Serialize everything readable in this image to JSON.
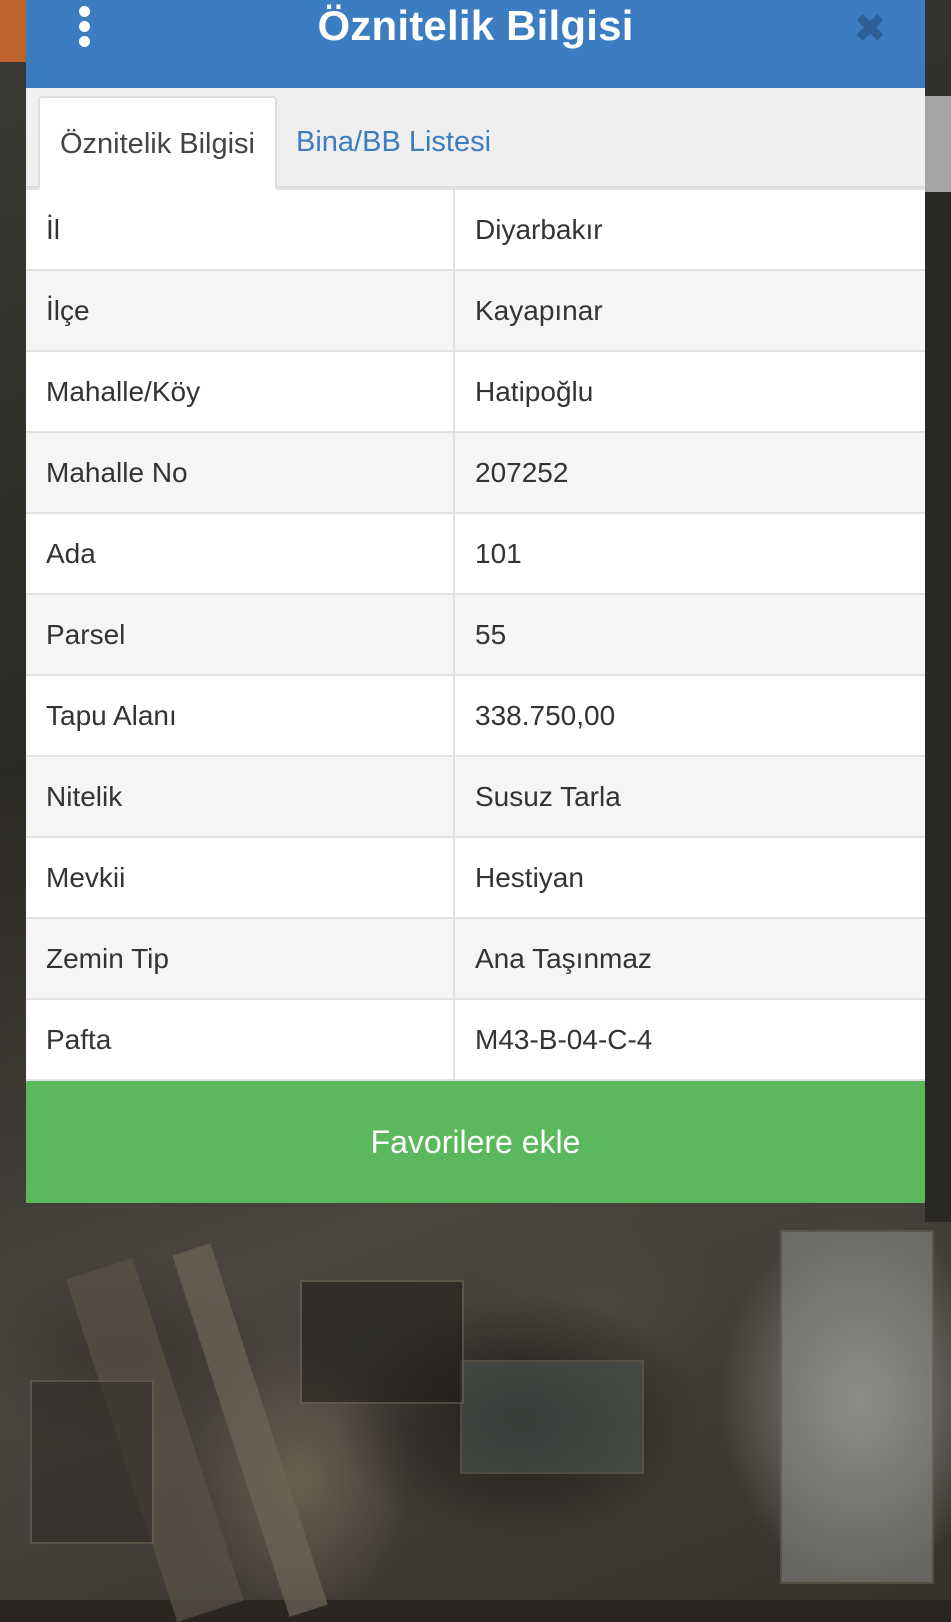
{
  "dialog": {
    "title": "Öznitelik Bilgisi",
    "menu_icon": "more-vertical-icon",
    "close_icon": "close-icon",
    "close_glyph": "✖"
  },
  "tabs": [
    {
      "label": "Öznitelik Bilgisi",
      "active": true
    },
    {
      "label": "Bina/BB Listesi",
      "active": false
    }
  ],
  "attributes": [
    {
      "label": "İl",
      "value": "Diyarbakır"
    },
    {
      "label": "İlçe",
      "value": "Kayapınar"
    },
    {
      "label": "Mahalle/Köy",
      "value": "Hatipoğlu"
    },
    {
      "label": "Mahalle No",
      "value": "207252"
    },
    {
      "label": "Ada",
      "value": "101"
    },
    {
      "label": "Parsel",
      "value": "55"
    },
    {
      "label": "Tapu Alanı",
      "value": "338.750,00"
    },
    {
      "label": "Nitelik",
      "value": "Susuz Tarla"
    },
    {
      "label": "Mevkii",
      "value": "Hestiyan"
    },
    {
      "label": "Zemin Tip",
      "value": "Ana Taşınmaz"
    },
    {
      "label": "Pafta",
      "value": "M43-B-04-C-4"
    }
  ],
  "actions": {
    "favorite_label": "Favorilere ekle"
  },
  "colors": {
    "header": "#3c7cc0",
    "tab_link": "#3c7cc0",
    "button": "#5cb85c"
  }
}
